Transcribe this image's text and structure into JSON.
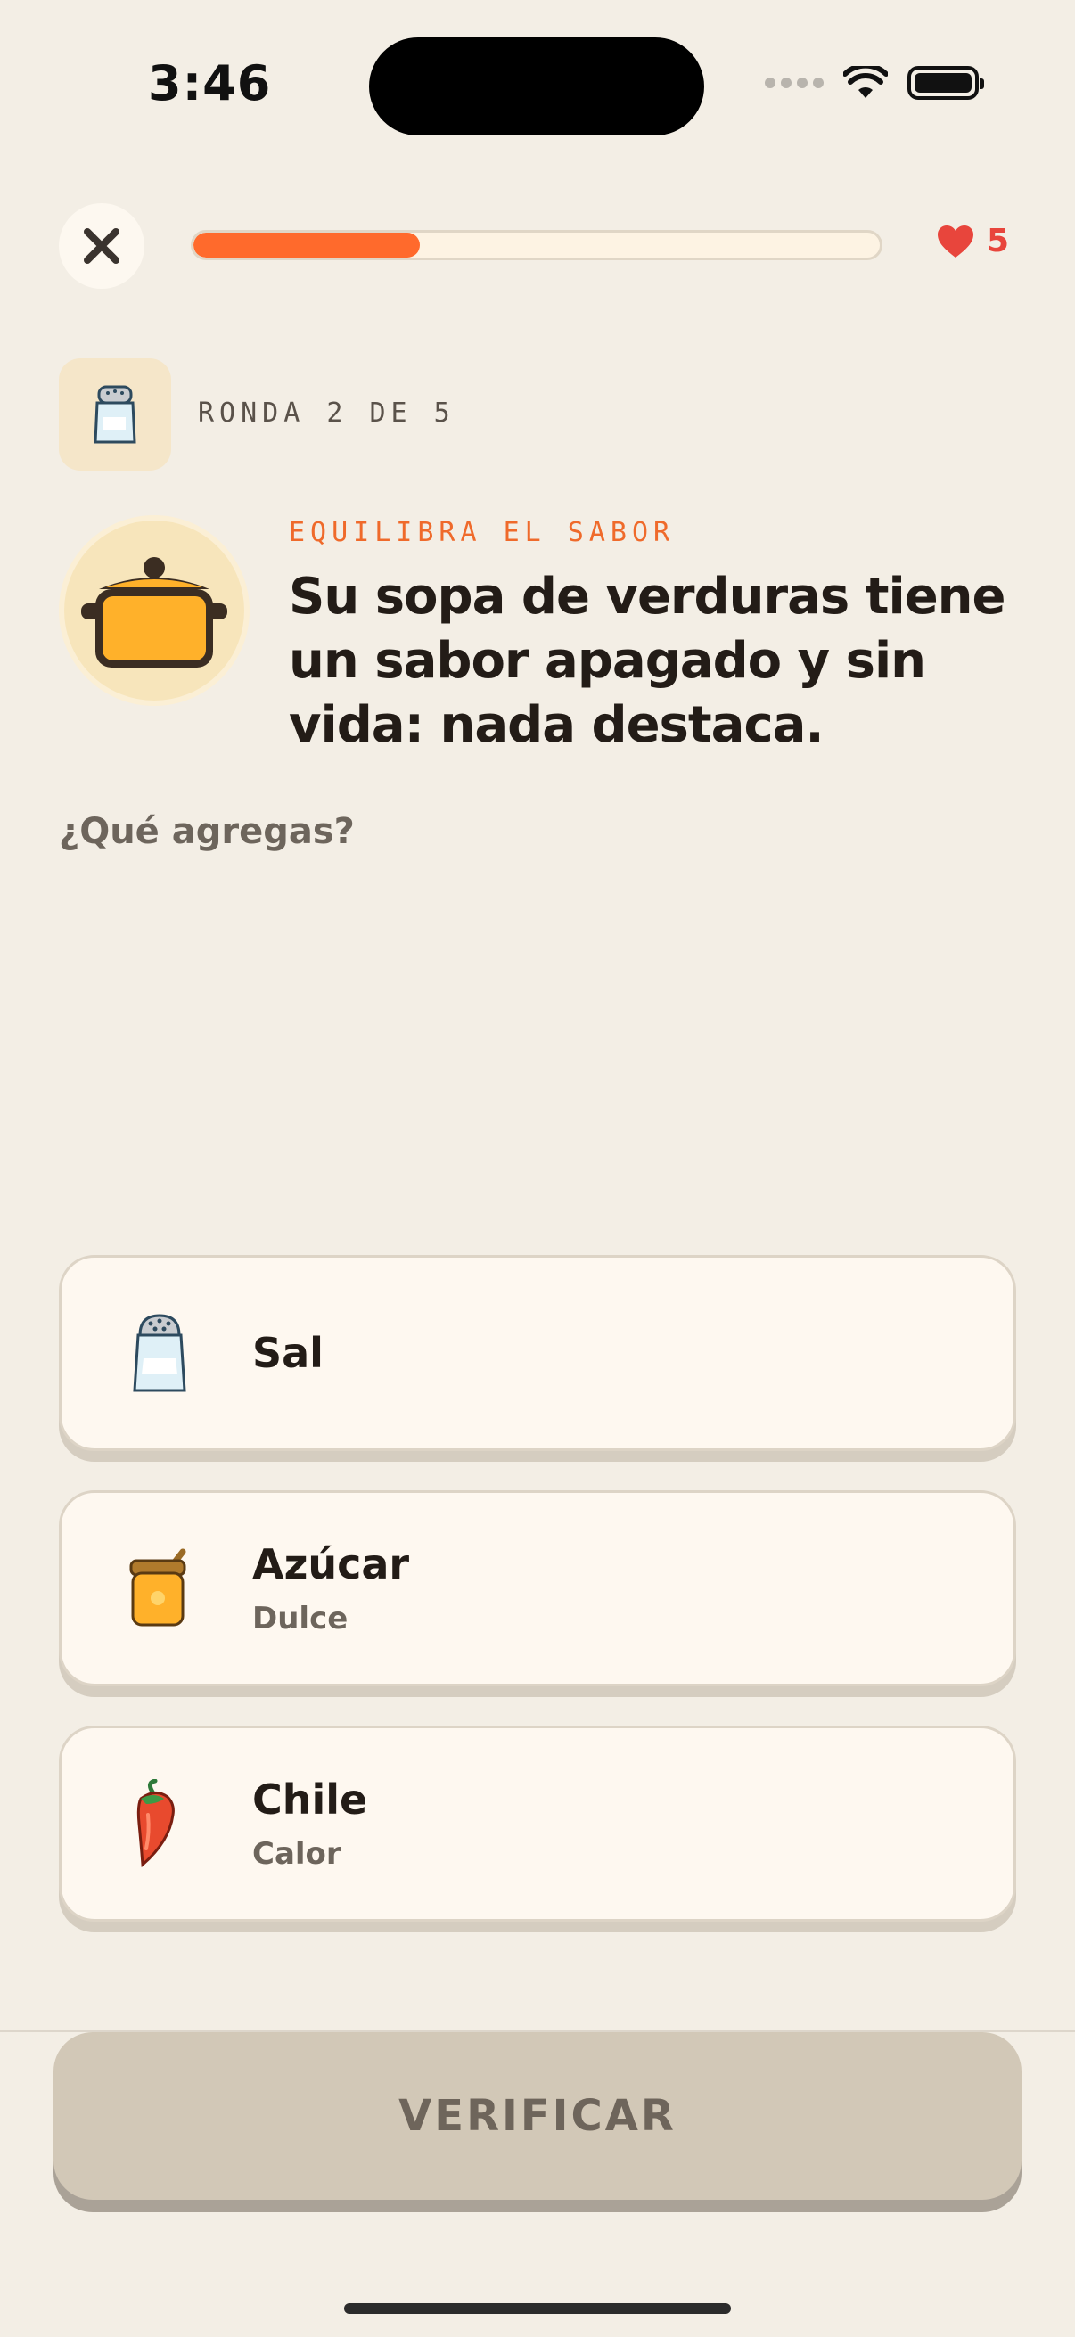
{
  "status_bar": {
    "time": "3:46"
  },
  "header": {
    "progress_fraction": 0.33,
    "lives": "5"
  },
  "round": {
    "label": "RONDA 2 DE 5"
  },
  "question": {
    "eyebrow": "EQUILIBRA EL SABOR",
    "text": "Su sopa de verduras tiene un sabor apagado y sin vida: nada destaca.",
    "prompt": "¿Qué agregas?"
  },
  "options": [
    {
      "title": "Sal",
      "subtitle": "",
      "icon": "salt-shaker-icon"
    },
    {
      "title": "Azúcar",
      "subtitle": "Dulce",
      "icon": "sugar-jar-icon"
    },
    {
      "title": "Chile",
      "subtitle": "Calor",
      "icon": "chili-pepper-icon"
    }
  ],
  "footer": {
    "verify_label": "VERIFICAR"
  },
  "colors": {
    "accent": "#ff6a2c",
    "heart": "#e8453c",
    "background": "#f3eee5"
  }
}
